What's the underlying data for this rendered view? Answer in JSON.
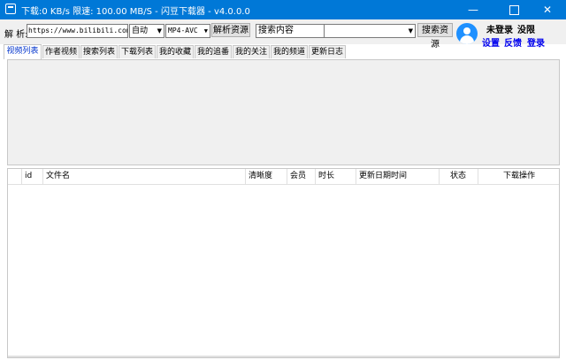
{
  "window": {
    "title": "下载:0 KB/s  限速: 100.00 MB/S  - 闪豆下载器 - v4.0.0.0",
    "minimize_glyph": "—",
    "close_glyph": "✕"
  },
  "toolbar": {
    "parse_label": "解 析:",
    "url_value": "https://www.bilibili.com/v",
    "quality_value": "自动",
    "codec_value": "MP4-AVC",
    "parse_button": "解析资源",
    "search_placeholder": "搜索内容",
    "search_type_value": "",
    "search_button": "搜索资源",
    "dropdown_arrow": "▼"
  },
  "user": {
    "login_status": "未登录",
    "vip_status": "没限",
    "settings_link": "设置",
    "feedback_link": "反馈",
    "login_link": "登录"
  },
  "tabs": [
    {
      "label": "视频列表",
      "active": true
    },
    {
      "label": "作者视频",
      "active": false
    },
    {
      "label": "搜索列表",
      "active": false
    },
    {
      "label": "下载列表",
      "active": false
    },
    {
      "label": "我的收藏",
      "active": false
    },
    {
      "label": "我的追番",
      "active": false
    },
    {
      "label": "我的关注",
      "active": false
    },
    {
      "label": "我的频道",
      "active": false
    },
    {
      "label": "更新日志",
      "active": false
    }
  ],
  "table": {
    "columns": [
      "",
      "id",
      "文件名",
      "清晰度",
      "会员",
      "时长",
      "更新日期时间",
      "状态",
      "下载操作"
    ],
    "rows": []
  },
  "colors": {
    "titlebar": "#0078d7",
    "link": "#0000ee",
    "avatar": "#1e90ff"
  }
}
